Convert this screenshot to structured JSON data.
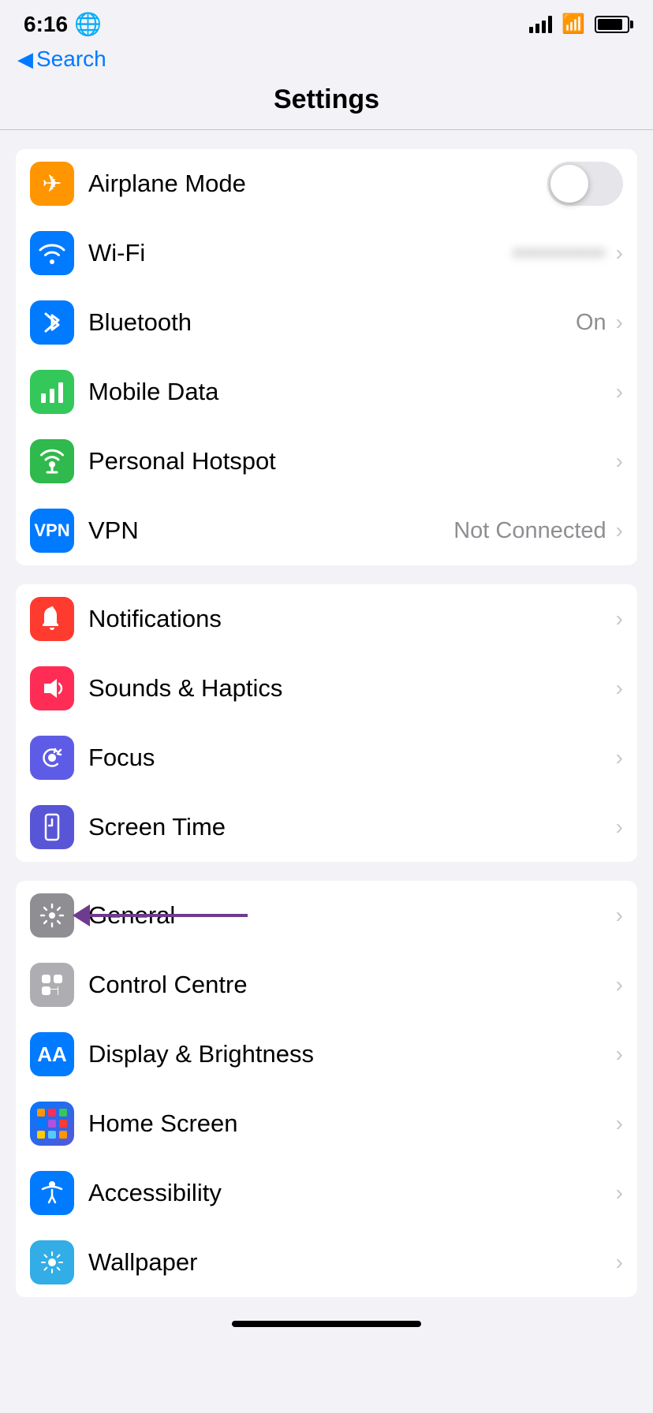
{
  "statusBar": {
    "time": "6:16",
    "globe": "🌐"
  },
  "nav": {
    "backLabel": "Search"
  },
  "page": {
    "title": "Settings"
  },
  "sections": [
    {
      "id": "connectivity",
      "rows": [
        {
          "id": "airplane-mode",
          "label": "Airplane Mode",
          "iconBg": "icon-orange",
          "iconSymbol": "✈",
          "type": "toggle",
          "toggleOn": false
        },
        {
          "id": "wifi",
          "label": "Wi-Fi",
          "iconBg": "icon-blue",
          "iconSymbol": "wifi",
          "type": "chevron-value",
          "value": "••••••••••••"
        },
        {
          "id": "bluetooth",
          "label": "Bluetooth",
          "iconBg": "icon-blue",
          "iconSymbol": "bluetooth",
          "type": "chevron-value",
          "value": "On"
        },
        {
          "id": "mobile-data",
          "label": "Mobile Data",
          "iconBg": "icon-green",
          "iconSymbol": "signal",
          "type": "chevron"
        },
        {
          "id": "personal-hotspot",
          "label": "Personal Hotspot",
          "iconBg": "icon-green2",
          "iconSymbol": "chain",
          "type": "chevron"
        },
        {
          "id": "vpn",
          "label": "VPN",
          "iconBg": "icon-vpn",
          "iconSymbol": "VPN",
          "type": "chevron-value",
          "value": "Not Connected"
        }
      ]
    },
    {
      "id": "notifications",
      "rows": [
        {
          "id": "notifications",
          "label": "Notifications",
          "iconBg": "icon-red",
          "iconSymbol": "bell",
          "type": "chevron"
        },
        {
          "id": "sounds-haptics",
          "label": "Sounds & Haptics",
          "iconBg": "icon-pink",
          "iconSymbol": "speaker",
          "type": "chevron"
        },
        {
          "id": "focus",
          "label": "Focus",
          "iconBg": "icon-purple",
          "iconSymbol": "moon",
          "type": "chevron"
        },
        {
          "id": "screen-time",
          "label": "Screen Time",
          "iconBg": "icon-indigo",
          "iconSymbol": "hourglass",
          "type": "chevron"
        }
      ]
    },
    {
      "id": "system",
      "rows": [
        {
          "id": "general",
          "label": "General",
          "iconBg": "icon-gray",
          "iconSymbol": "gear",
          "type": "chevron",
          "annotated": true
        },
        {
          "id": "control-centre",
          "label": "Control Centre",
          "iconBg": "icon-gray2",
          "iconSymbol": "sliders",
          "type": "chevron"
        },
        {
          "id": "display-brightness",
          "label": "Display & Brightness",
          "iconBg": "icon-blue",
          "iconSymbol": "AA",
          "type": "chevron"
        },
        {
          "id": "home-screen",
          "label": "Home Screen",
          "iconBg": "icon-homescreen",
          "iconSymbol": "grid",
          "type": "chevron"
        },
        {
          "id": "accessibility",
          "label": "Accessibility",
          "iconBg": "icon-blue",
          "iconSymbol": "person",
          "type": "chevron"
        },
        {
          "id": "wallpaper",
          "label": "Wallpaper",
          "iconBg": "icon-teal",
          "iconSymbol": "flower",
          "type": "chevron"
        }
      ]
    }
  ]
}
